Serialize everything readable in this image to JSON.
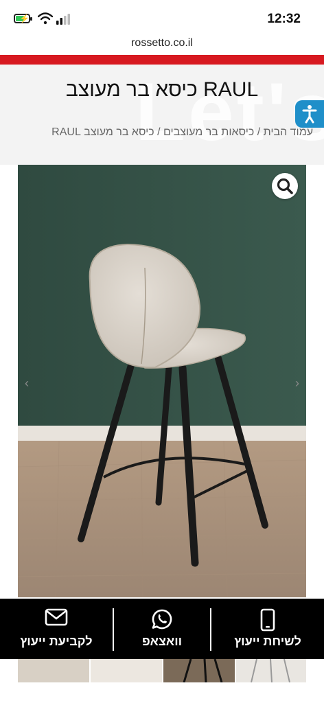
{
  "status": {
    "time": "12:32"
  },
  "browser": {
    "url": "rossetto.co.il"
  },
  "header": {
    "title": "כיסא בר מעוצב RAUL",
    "breadcrumb": "עמוד הבית / כיסאות בר מעוצבים / כיסא בר מעוצב RAUL"
  },
  "gallery": {
    "prev_icon": "chevron-left-icon",
    "next_icon": "chevron-right-icon"
  },
  "cta": [
    {
      "label": "לקביעת ייעוץ",
      "icon": "envelope-icon"
    },
    {
      "label": "וואצאפ",
      "icon": "whatsapp-icon"
    },
    {
      "label": "לשיחת ייעוץ",
      "icon": "mobile-phone-icon"
    }
  ],
  "colors": {
    "brand_red": "#d71920",
    "accessibility_blue": "#1f8fc9",
    "bottom_bar": "#000000"
  }
}
